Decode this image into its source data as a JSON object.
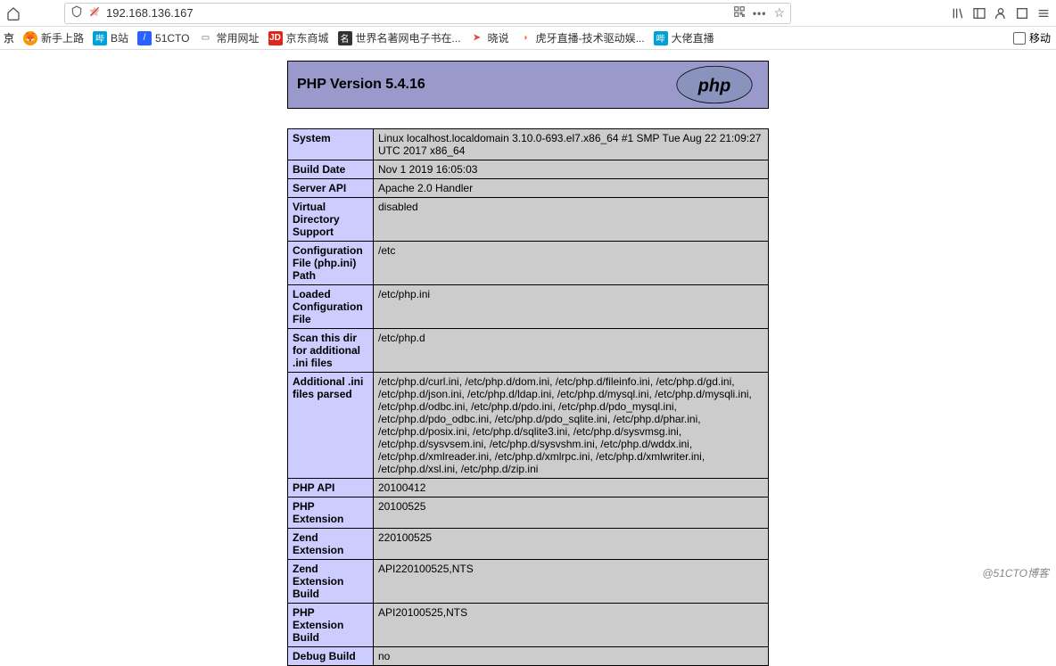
{
  "toolbar": {
    "url": "192.168.136.167"
  },
  "bookmarks": {
    "partial_left": "京",
    "items": [
      {
        "icon": "ff",
        "label": "新手上路"
      },
      {
        "icon": "bili",
        "label": "B站"
      },
      {
        "icon": "cto",
        "label": "51CTO"
      },
      {
        "icon": "folder",
        "label": "常用网址"
      },
      {
        "icon": "jd",
        "label": "京东商城"
      },
      {
        "icon": "book",
        "label": "世界名著网电子书在..."
      },
      {
        "icon": "xs",
        "label": "晓说"
      },
      {
        "icon": "hu",
        "label": "虎牙直播-技术驱动娱..."
      },
      {
        "icon": "dl",
        "label": "大佬直播"
      }
    ],
    "mobile_label": "移动"
  },
  "php": {
    "title": "PHP Version 5.4.16",
    "logo_text": "php",
    "rows": [
      {
        "key": "System",
        "val": "Linux localhost.localdomain 3.10.0-693.el7.x86_64 #1 SMP Tue Aug 22 21:09:27 UTC 2017 x86_64"
      },
      {
        "key": "Build Date",
        "val": "Nov 1 2019 16:05:03"
      },
      {
        "key": "Server API",
        "val": "Apache 2.0 Handler"
      },
      {
        "key": "Virtual Directory Support",
        "val": "disabled"
      },
      {
        "key": "Configuration File (php.ini) Path",
        "val": "/etc"
      },
      {
        "key": "Loaded Configuration File",
        "val": "/etc/php.ini"
      },
      {
        "key": "Scan this dir for additional .ini files",
        "val": "/etc/php.d"
      },
      {
        "key": "Additional .ini files parsed",
        "val": "/etc/php.d/curl.ini, /etc/php.d/dom.ini, /etc/php.d/fileinfo.ini, /etc/php.d/gd.ini, /etc/php.d/json.ini, /etc/php.d/ldap.ini, /etc/php.d/mysql.ini, /etc/php.d/mysqli.ini, /etc/php.d/odbc.ini, /etc/php.d/pdo.ini, /etc/php.d/pdo_mysql.ini, /etc/php.d/pdo_odbc.ini, /etc/php.d/pdo_sqlite.ini, /etc/php.d/phar.ini, /etc/php.d/posix.ini, /etc/php.d/sqlite3.ini, /etc/php.d/sysvmsg.ini, /etc/php.d/sysvsem.ini, /etc/php.d/sysvshm.ini, /etc/php.d/wddx.ini, /etc/php.d/xmlreader.ini, /etc/php.d/xmlrpc.ini, /etc/php.d/xmlwriter.ini, /etc/php.d/xsl.ini, /etc/php.d/zip.ini"
      },
      {
        "key": "PHP API",
        "val": "20100412"
      },
      {
        "key": "PHP Extension",
        "val": "20100525"
      },
      {
        "key": "Zend Extension",
        "val": "220100525"
      },
      {
        "key": "Zend Extension Build",
        "val": "API220100525,NTS"
      },
      {
        "key": "PHP Extension Build",
        "val": "API20100525,NTS"
      },
      {
        "key": "Debug Build",
        "val": "no"
      }
    ]
  },
  "watermark": "@51CTO博客"
}
